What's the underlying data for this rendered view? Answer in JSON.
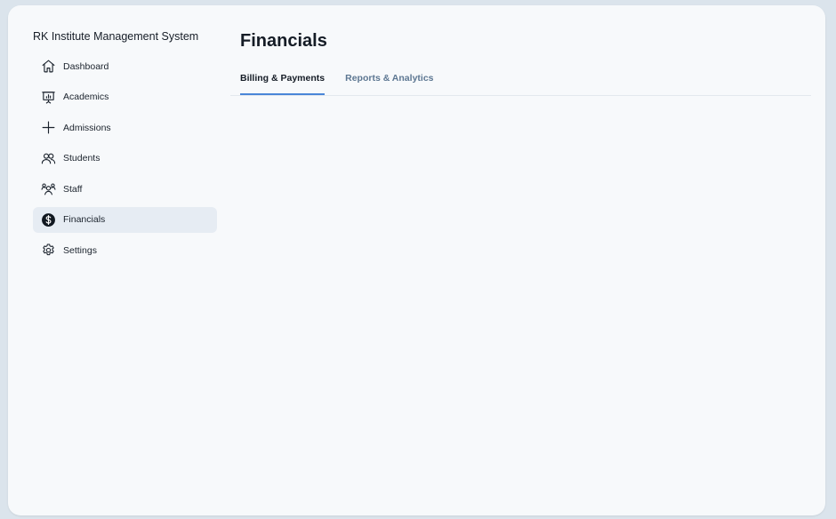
{
  "app": {
    "title": "RK Institute Management System"
  },
  "sidebar": {
    "items": [
      {
        "label": "Dashboard",
        "icon": "home-icon",
        "active": false
      },
      {
        "label": "Academics",
        "icon": "presentation-chart-icon",
        "active": false
      },
      {
        "label": "Admissions",
        "icon": "plus-icon",
        "active": false
      },
      {
        "label": "Students",
        "icon": "users-icon",
        "active": false
      },
      {
        "label": "Staff",
        "icon": "group-icon",
        "active": false
      },
      {
        "label": "Financials",
        "icon": "dollar-circle-icon",
        "active": true
      },
      {
        "label": "Settings",
        "icon": "gear-icon",
        "active": false
      }
    ]
  },
  "main": {
    "title": "Financials",
    "tabs": [
      {
        "label": "Billing & Payments",
        "active": true
      },
      {
        "label": "Reports & Analytics",
        "active": false
      }
    ]
  },
  "colors": {
    "accent": "#4a86d8",
    "active_nav_bg": "#e6ecf3",
    "inactive_tab": "#5d7792",
    "background": "#f7f9fb",
    "outer_background": "#dbe4ec"
  }
}
